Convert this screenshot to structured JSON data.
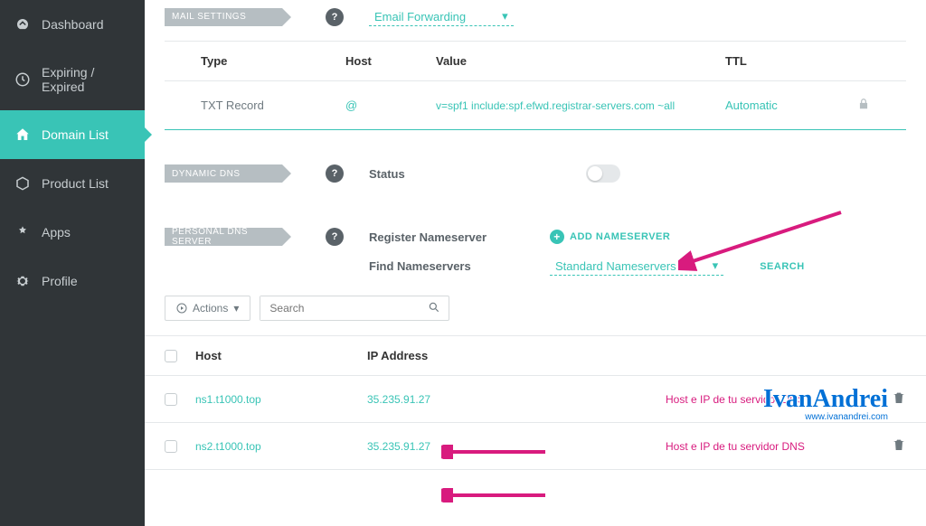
{
  "sidebar": {
    "items": [
      {
        "label": "Dashboard",
        "icon": "gauge-icon"
      },
      {
        "label": "Expiring / Expired",
        "icon": "clock-icon"
      },
      {
        "label": "Domain List",
        "icon": "house-icon"
      },
      {
        "label": "Product List",
        "icon": "box-icon"
      },
      {
        "label": "Apps",
        "icon": "apps-icon"
      },
      {
        "label": "Profile",
        "icon": "gear-icon"
      }
    ]
  },
  "mail_settings": {
    "tag": "MAIL SETTINGS",
    "dropdown": "Email Forwarding"
  },
  "records_table": {
    "headers": {
      "type": "Type",
      "host": "Host",
      "value": "Value",
      "ttl": "TTL"
    },
    "rows": [
      {
        "type": "TXT Record",
        "host": "@",
        "value": "v=spf1 include:spf.efwd.registrar-servers.com ~all",
        "ttl": "Automatic"
      }
    ]
  },
  "dynamic_dns": {
    "tag": "DYNAMIC DNS",
    "status_label": "Status"
  },
  "personal_dns": {
    "tag": "PERSONAL DNS SERVER",
    "register_label": "Register Nameserver",
    "add_label": "ADD NAMESERVER",
    "find_label": "Find Nameservers",
    "std_label": "Standard Nameservers",
    "search_label": "SEARCH"
  },
  "toolbar": {
    "actions_label": "Actions",
    "search_placeholder": "Search"
  },
  "ns_table": {
    "headers": {
      "host": "Host",
      "ip": "IP Address"
    },
    "rows": [
      {
        "host": "ns1.t1000.top",
        "ip": "35.235.91.27"
      },
      {
        "host": "ns2.t1000.top",
        "ip": "35.235.91.27"
      }
    ]
  },
  "annotations": {
    "row": "Host e IP de tu servidor DNS"
  },
  "watermark": {
    "name": "IvanAndrei",
    "url": "www.ivanandrei.com"
  },
  "colors": {
    "teal": "#39c4b6",
    "pink": "#d81b7e",
    "sidebar_bg": "#303538"
  }
}
